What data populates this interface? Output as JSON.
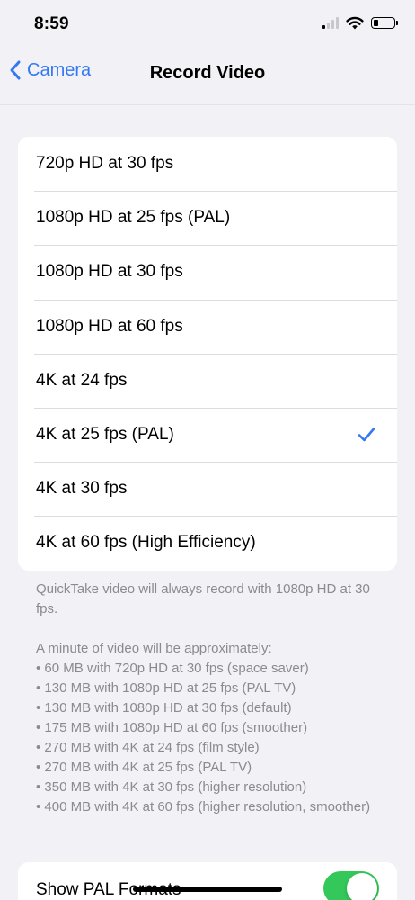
{
  "status_bar": {
    "time": "8:59"
  },
  "nav": {
    "back_label": "Camera",
    "title": "Record Video"
  },
  "options": [
    {
      "label": "720p HD at 30 fps",
      "selected": false
    },
    {
      "label": "1080p HD at 25 fps (PAL)",
      "selected": false
    },
    {
      "label": "1080p HD at 30 fps",
      "selected": false
    },
    {
      "label": "1080p HD at 60 fps",
      "selected": false
    },
    {
      "label": "4K at 24 fps",
      "selected": false
    },
    {
      "label": "4K at 25 fps (PAL)",
      "selected": true
    },
    {
      "label": "4K at 30 fps",
      "selected": false
    },
    {
      "label": "4K at 60 fps (High Efficiency)",
      "selected": false
    }
  ],
  "notes": {
    "quicktake": "QuickTake video will always record with 1080p HD at 30 fps.",
    "size_intro": "A minute of video will be approximately:",
    "size_lines": [
      "• 60 MB with 720p HD at 30 fps (space saver)",
      "• 130 MB with 1080p HD at 25 fps (PAL TV)",
      "• 130 MB with 1080p HD at 30 fps (default)",
      "• 175 MB with 1080p HD at 60 fps (smoother)",
      "• 270 MB with 4K at 24 fps (film style)",
      "• 270 MB with 4K at 25 fps (PAL TV)",
      "• 350 MB with 4K at 30 fps (higher resolution)",
      "• 400 MB with 4K at 60 fps (higher resolution, smoother)"
    ]
  },
  "pal_toggle": {
    "label": "Show PAL Formats",
    "on": true
  },
  "colors": {
    "accent": "#3478f6",
    "toggle_on": "#34c759",
    "background": "#f2f2f6",
    "footer_text": "#8a8a8f"
  }
}
